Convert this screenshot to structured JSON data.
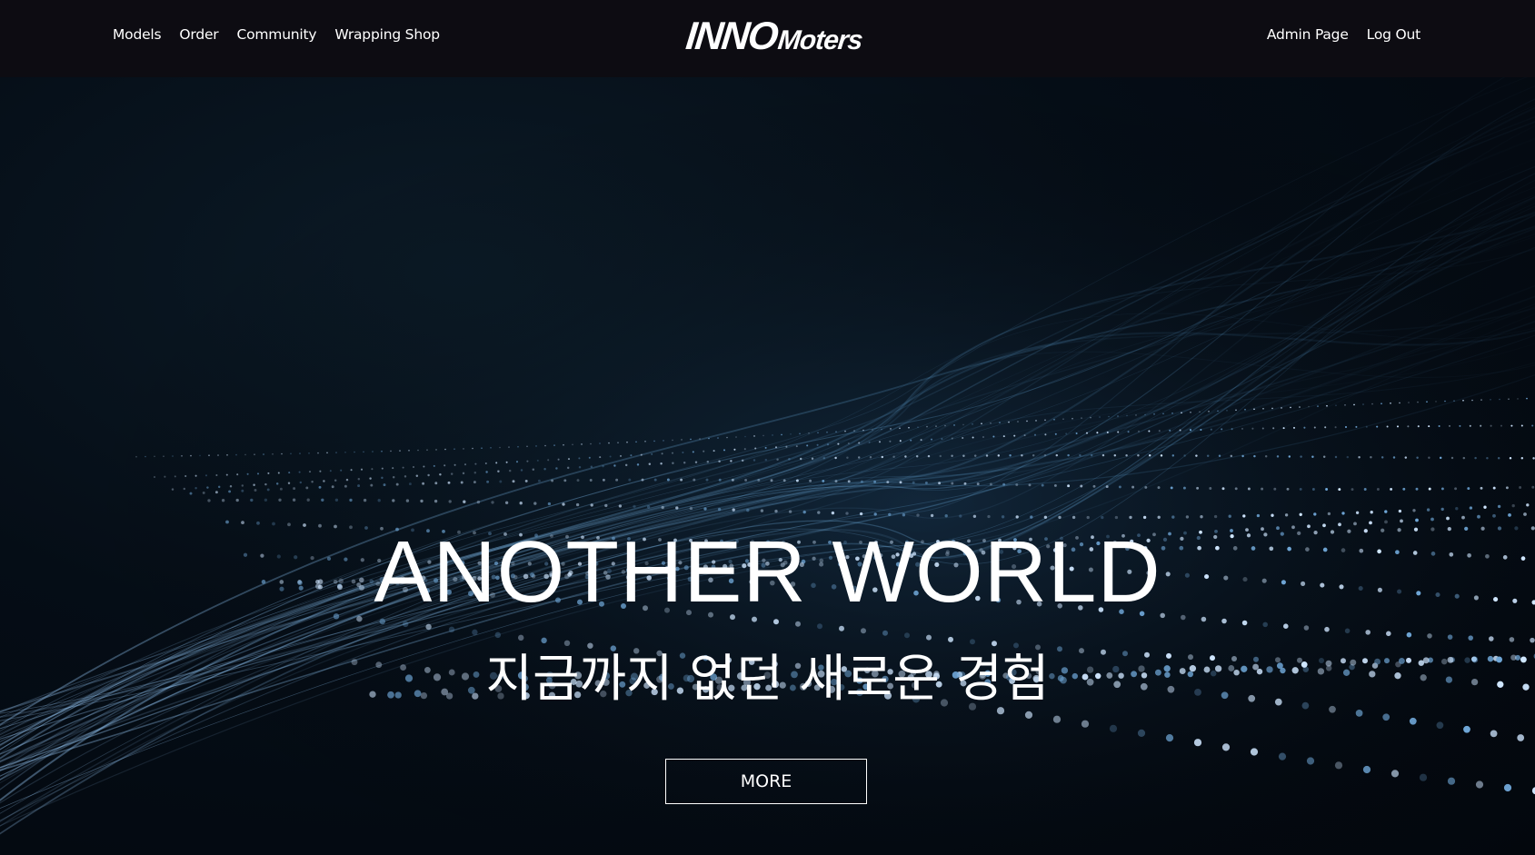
{
  "nav": {
    "left_links": [
      "Models",
      "Order",
      "Community",
      "Wrapping Shop"
    ],
    "right_links": [
      "Admin Page",
      "Log Out"
    ]
  },
  "logo": {
    "primary": "INNO",
    "secondary": "Moters"
  },
  "hero": {
    "title": "ANOTHER WORLD",
    "subtitle": "지금까지 없던 새로운 경험",
    "button_label": "MORE",
    "background": "abstract-particle-waves",
    "accent_color": "#7fb8e8"
  },
  "colors": {
    "topbar": "#0d0c12",
    "hero_bg": "#050d16",
    "text": "#ffffff"
  }
}
